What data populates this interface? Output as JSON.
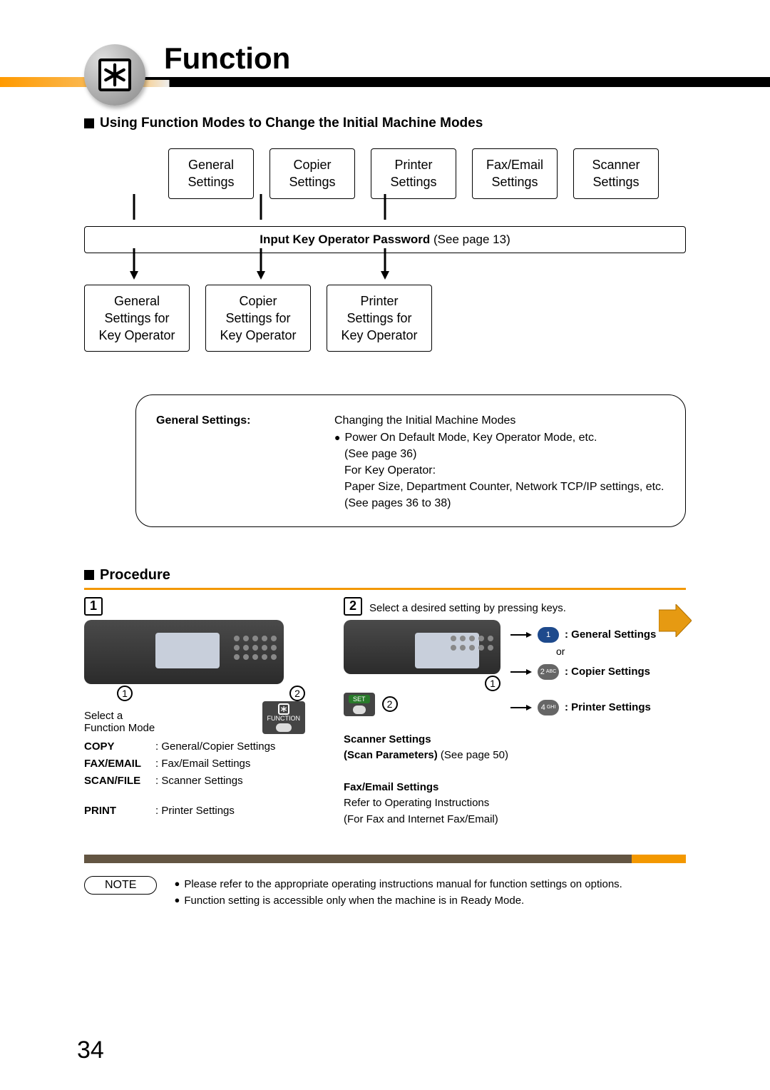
{
  "header": {
    "title": "Function",
    "icon": "asterisk-icon"
  },
  "section_title": "Using Function Modes to Change the Initial Machine Modes",
  "top_boxes": [
    "General\nSettings",
    "Copier\nSettings",
    "Printer\nSettings",
    "Fax/Email\nSettings",
    "Scanner\nSettings"
  ],
  "password_bar": {
    "bold": "Input Key Operator Password",
    "rest": " (See page 13)"
  },
  "bottom_boxes": [
    "General\nSettings for\nKey Operator",
    "Copier\nSettings for\nKey Operator",
    "Printer\nSettings for\nKey Operator"
  ],
  "detail": {
    "label": "General Settings:",
    "heading": "Changing the Initial Machine Modes",
    "bullet1": "Power On Default Mode, Key Operator Mode, etc.",
    "line2": "(See page 36)",
    "line3": "For Key Operator:",
    "line4": "Paper Size, Department Counter, Network TCP/IP settings, etc.",
    "line5": "(See pages 36 to 38)"
  },
  "procedure": {
    "heading": "Procedure",
    "step1": {
      "num": "1",
      "select_label": "Select a\nFunction Mode",
      "function_key": "FUNCTION",
      "modes": [
        {
          "label": "COPY",
          "value": ": General/Copier Settings"
        },
        {
          "label": "FAX/EMAIL",
          "value": ": Fax/Email Settings"
        },
        {
          "label": "SCAN/FILE",
          "value": ": Scanner Settings"
        },
        {
          "label": "PRINT",
          "value": ": Printer Settings"
        }
      ],
      "c1": "1",
      "c2": "2"
    },
    "step2": {
      "num": "2",
      "intro": "Select a desired setting by pressing keys.",
      "set_key": "SET",
      "or": "or",
      "keys": [
        {
          "k": "1",
          "label": ": General Settings"
        },
        {
          "k": "2",
          "sub": "ABC",
          "label": ": Copier Settings"
        },
        {
          "k": "4",
          "sub": "GHI",
          "label": ": Printer Settings"
        }
      ],
      "scanner_block": {
        "l1": "Scanner Settings",
        "l2": "Scan Parameters)",
        "l2_prefix": "(",
        "l2_rest": " (See page 50)"
      },
      "fax_block": {
        "l1": "Fax/Email Settings",
        "l2": "Refer to Operating Instructions",
        "l3": "(For Fax and Internet Fax/Email)"
      },
      "c1": "1",
      "c2": "2"
    }
  },
  "note": {
    "label": "NOTE",
    "items": [
      "Please refer to the appropriate operating instructions manual for function settings on options.",
      "Function setting is accessible only when the machine is in Ready Mode."
    ]
  },
  "page_number": "34"
}
